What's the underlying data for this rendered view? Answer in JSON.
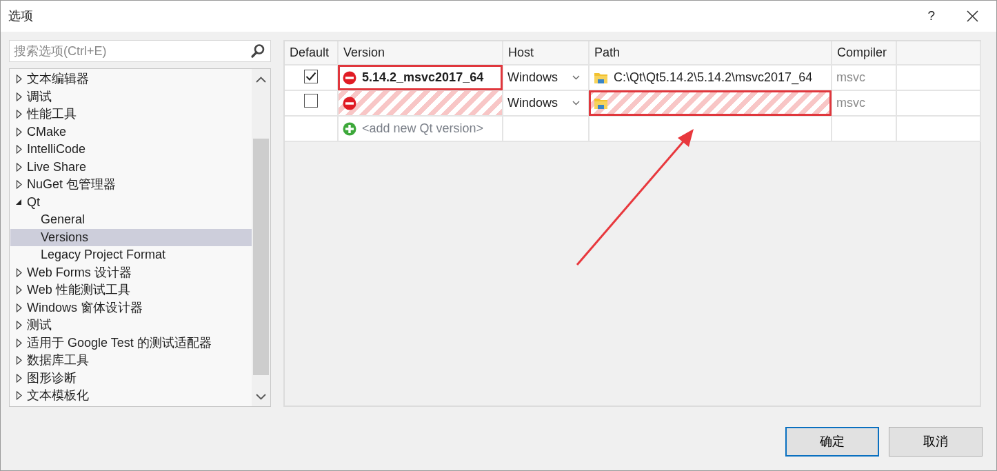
{
  "window": {
    "title": "选项",
    "help": "?"
  },
  "search": {
    "placeholder": "搜索选项(Ctrl+E)"
  },
  "tree": [
    {
      "label": "文本编辑器",
      "expanded": false,
      "selected": false
    },
    {
      "label": "调试",
      "expanded": false,
      "selected": false
    },
    {
      "label": "性能工具",
      "expanded": false,
      "selected": false
    },
    {
      "label": "CMake",
      "expanded": false,
      "selected": false
    },
    {
      "label": "IntelliCode",
      "expanded": false,
      "selected": false
    },
    {
      "label": "Live Share",
      "expanded": false,
      "selected": false
    },
    {
      "label": "NuGet 包管理器",
      "expanded": false,
      "selected": false
    },
    {
      "label": "Qt",
      "expanded": true,
      "selected": false,
      "children": [
        {
          "label": "General",
          "selected": false
        },
        {
          "label": "Versions",
          "selected": true
        },
        {
          "label": "Legacy Project Format",
          "selected": false
        }
      ]
    },
    {
      "label": "Web Forms 设计器",
      "expanded": false,
      "selected": false
    },
    {
      "label": "Web 性能测试工具",
      "expanded": false,
      "selected": false
    },
    {
      "label": "Windows 窗体设计器",
      "expanded": false,
      "selected": false
    },
    {
      "label": "测试",
      "expanded": false,
      "selected": false
    },
    {
      "label": "适用于 Google Test 的测试适配器",
      "expanded": false,
      "selected": false
    },
    {
      "label": "数据库工具",
      "expanded": false,
      "selected": false
    },
    {
      "label": "图形诊断",
      "expanded": false,
      "selected": false
    },
    {
      "label": "文本模板化",
      "expanded": false,
      "selected": false
    }
  ],
  "table": {
    "columns": [
      "Default",
      "Version",
      "Host",
      "Path",
      "Compiler"
    ],
    "rows": [
      {
        "default": true,
        "invalid": false,
        "version": "5.14.2_msvc2017_64",
        "host": "Windows",
        "path": "C:\\Qt\\Qt5.14.2\\5.14.2\\msvc2017_64",
        "compiler": "msvc",
        "version_marked": true,
        "path_marked": false
      },
      {
        "default": false,
        "invalid": true,
        "host": "Windows",
        "compiler": "msvc",
        "version_marked": false,
        "path_marked": true
      }
    ],
    "add_row": "<add new Qt version>"
  },
  "buttons": [
    {
      "label": "确定",
      "focused": true
    },
    {
      "label": "取消",
      "focused": false
    }
  ]
}
